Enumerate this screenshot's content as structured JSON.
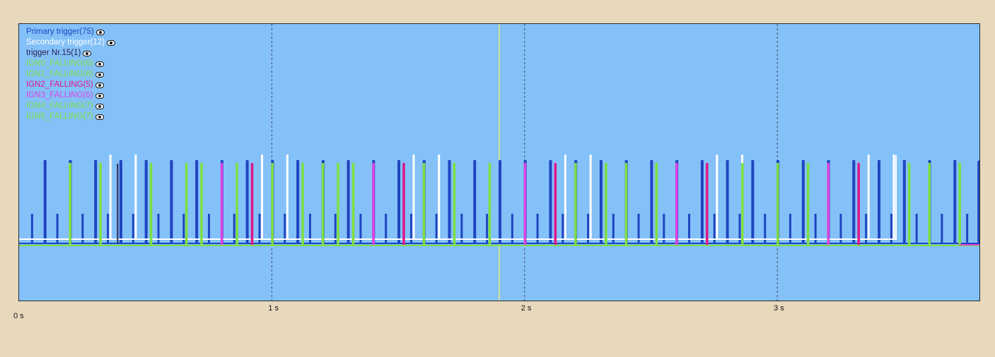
{
  "chart_data": {
    "type": "line",
    "xlim": [
      0,
      3.8
    ],
    "x_ticks": [
      {
        "value": 1,
        "label": "1 s"
      },
      {
        "value": 2,
        "label": "2 s"
      },
      {
        "value": 3,
        "label": "3 s"
      }
    ],
    "x_origin_label": "0 s",
    "cursor_x": 1.9,
    "grid": true,
    "legend_position": "top-left",
    "series": [
      {
        "name": "Primary trigger(75)",
        "color": "#1f45c0",
        "kind": "primary",
        "period": 0.1,
        "tall_offset": 0.095,
        "short_offset": 0.0,
        "end": 3.795
      },
      {
        "name": "Secondary trigger(12)",
        "color": "#ffffff",
        "kind": "secondary",
        "pairs": [
          0.36,
          0.46,
          0.96,
          1.06,
          1.56,
          1.66,
          2.16,
          2.26,
          2.76,
          2.86,
          3.36,
          3.46
        ],
        "end": 3.47
      },
      {
        "name": "trigger Nr.15(1)",
        "color": "#2a2050",
        "kind": "single",
        "x": [
          0.39
        ]
      },
      {
        "name": "IGN0_FALLING(6)",
        "color": "#7ee040",
        "kind": "falling",
        "x": [
          0.2,
          0.72,
          1.2,
          1.72,
          2.2,
          2.72,
          3.2
        ]
      },
      {
        "name": "IGN1_FALLING(6)",
        "color": "#7ee040",
        "kind": "falling",
        "x": [
          0.32,
          0.86,
          1.32,
          1.86,
          2.32,
          2.86,
          3.32
        ]
      },
      {
        "name": "IGN2_FALLING(5)",
        "color": "#e0158a",
        "kind": "falling",
        "x": [
          0.92,
          1.52,
          2.12,
          2.72,
          3.32
        ]
      },
      {
        "name": "IGN3_FALLING(6)",
        "color": "#e040e0",
        "kind": "falling",
        "x": [
          0.8,
          1.4,
          2.0,
          2.6,
          3.2
        ]
      },
      {
        "name": "IGN4_FALLING(7)",
        "color": "#7ee040",
        "kind": "falling",
        "x": [
          0.52,
          1.12,
          1.6,
          2.52,
          3.12,
          3.6
        ]
      },
      {
        "name": "IGN5_FALLING(7)",
        "color": "#7ee040",
        "kind": "falling",
        "x": [
          0.66,
          1.0,
          1.26,
          2.4,
          3.0,
          3.52,
          3.72
        ]
      }
    ]
  }
}
